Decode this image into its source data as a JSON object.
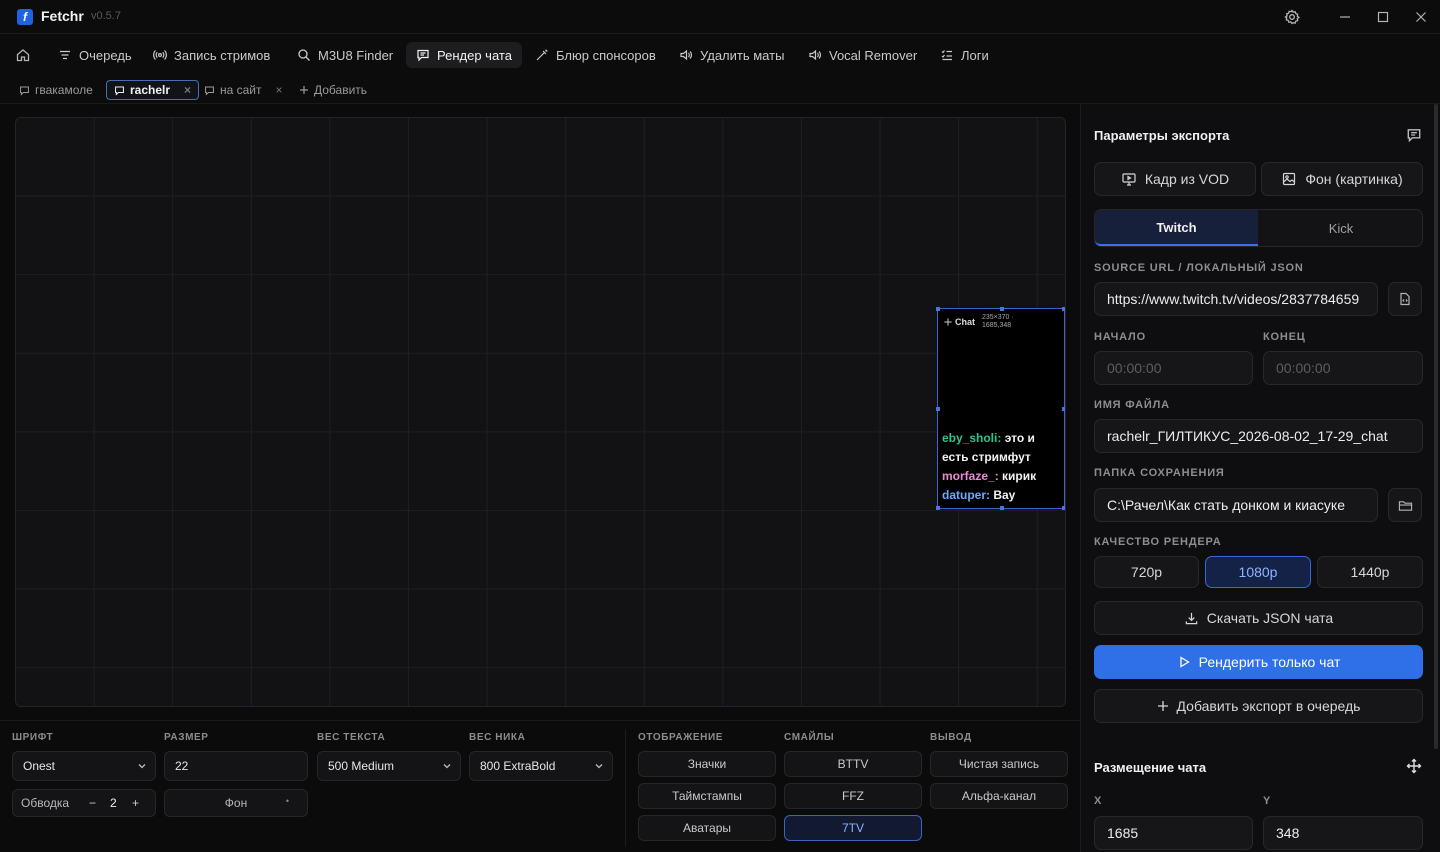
{
  "app": {
    "name": "Fetchr",
    "version": "v0.5.7",
    "logo_letter": "f"
  },
  "nav": {
    "items": [
      {
        "label": "Очередь",
        "icon": "queue-icon"
      },
      {
        "label": "Запись стримов",
        "icon": "broadcast-icon"
      },
      {
        "label": "M3U8 Finder",
        "icon": "search-icon"
      },
      {
        "label": "Рендер чата",
        "icon": "chat-icon",
        "active": true
      },
      {
        "label": "Блюр спонсоров",
        "icon": "wand-icon"
      },
      {
        "label": "Удалить маты",
        "icon": "speaker-icon"
      },
      {
        "label": "Vocal Remover",
        "icon": "speaker-icon"
      },
      {
        "label": "Логи",
        "icon": "list-icon"
      }
    ]
  },
  "tabs": {
    "items": [
      {
        "label": "гвакамоле"
      },
      {
        "label": "rachelr",
        "active": true
      },
      {
        "label": "на сайт"
      }
    ],
    "add_label": "Добавить",
    "close_glyph": "×"
  },
  "preview": {
    "chat_tag": "Chat",
    "chat_dims": "235×370 · 1685,348",
    "messages": [
      {
        "user": "eby_sholi:",
        "text": " это и есть стримфут",
        "color": "#2ec48a"
      },
      {
        "user": "morfaze_:",
        "text": " кирик",
        "color": "#e88ad4"
      },
      {
        "user": "datuper:",
        "text": " Bay",
        "color": "#6ea9ff"
      }
    ]
  },
  "controls": {
    "font_label": "ШРИФТ",
    "font_value": "Onest",
    "size_label": "РАЗМЕР",
    "size_value": "22",
    "text_weight_label": "ВЕС ТЕКСТА",
    "text_weight_value": "500 Medium",
    "nick_weight_label": "ВЕС НИКА",
    "nick_weight_value": "800 ExtraBold",
    "stroke_label": "Обводка",
    "stroke_minus": "−",
    "stroke_value": "2",
    "stroke_plus": "+",
    "bg_label": "Фон",
    "bg_glyph": "•",
    "display_label": "ОТОБРАЖЕНИЕ",
    "emotes_label": "СМАЙЛЫ",
    "output_label": "ВЫВОД",
    "display": [
      "Значки",
      "Таймстампы",
      "Аватары"
    ],
    "emotes": [
      "BTTV",
      "FFZ",
      "7TV"
    ],
    "output": [
      "Чистая запись",
      "Альфа-канал"
    ]
  },
  "export": {
    "title": "Параметры экспорта",
    "frame_vod": "Кадр из VOD",
    "bg_image": "Фон (картинка)",
    "platforms": [
      "Twitch",
      "Kick"
    ],
    "source_label": "SOURCE URL / ЛОКАЛЬНЫЙ JSON",
    "source_value": "https://www.twitch.tv/videos/2837784659",
    "start_label": "НАЧАЛО",
    "start_placeholder": "00:00:00",
    "end_label": "КОНЕЦ",
    "end_placeholder": "00:00:00",
    "filename_label": "ИМЯ ФАЙЛА",
    "filename_value": "rachelr_ГИЛТИКУС_2026-08-02_17-29_chat",
    "folder_label": "ПАПКА СОХРАНЕНИЯ",
    "folder_value": "C:\\Рачел\\Как стать донком и киасуке",
    "quality_label": "КАЧЕСТВО РЕНДЕРА",
    "qualities": [
      "720p",
      "1080p",
      "1440p"
    ],
    "download_json": "Скачать JSON чата",
    "render_only": "Рендерить только чат",
    "add_queue": "Добавить экспорт в очередь",
    "placement_title": "Размещение чата",
    "x_label": "X",
    "x_value": "1685",
    "y_label": "Y",
    "y_value": "348"
  },
  "colors": {
    "accent": "#2f6fe8",
    "background": "#0b0b0c",
    "active_border": "#3b63c4"
  }
}
